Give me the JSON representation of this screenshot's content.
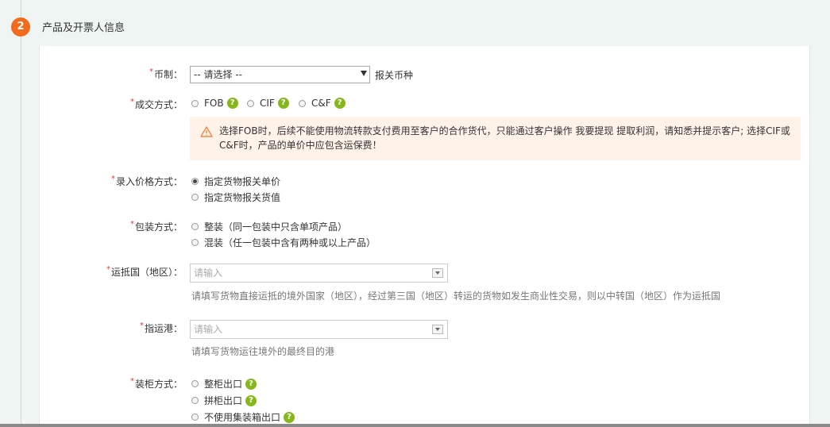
{
  "section": {
    "step": "2",
    "title": "产品及开票人信息"
  },
  "currency": {
    "label": "币制：",
    "selected": "-- 请选择 --",
    "suffix": "报关币种"
  },
  "trade_terms": {
    "label": "成交方式：",
    "options": [
      "FOB",
      "CIF",
      "C&F"
    ],
    "help": "?",
    "warning": "选择FOB时，后续不能使用物流转款支付费用至客户的合作货代，只能通过客户操作 我要提现 提取利润，请知悉并提示客户; 选择CIF或C&F时，产品的单价中应包含运保费！"
  },
  "price_method": {
    "label": "录入价格方式：",
    "options": [
      "指定货物报关单价",
      "指定货物报关货值"
    ],
    "selected_index": 0
  },
  "packing": {
    "label": "包装方式：",
    "options": [
      "整装（同一包装中只含单项产品）",
      "混装（任一包装中含有两种或以上产品）"
    ]
  },
  "destination_country": {
    "label": "运抵国（地区）：",
    "placeholder": "请输入",
    "hint": "请填写货物直接运抵的境外国家（地区），经过第三国（地区）转运的货物如发生商业性交易，则以中转国（地区）作为运抵国"
  },
  "destination_port": {
    "label": "指运港：",
    "placeholder": "请输入",
    "hint": "请填写货物运往境外的最终目的港"
  },
  "container": {
    "label": "装柜方式：",
    "options": [
      "整柜出口",
      "拼柜出口",
      "不使用集装箱出口"
    ],
    "help": "?"
  },
  "required_mark": "*",
  "colors": {
    "accent": "#f26a1b",
    "help": "#86b81c",
    "required": "#e4393c",
    "warning_bg": "#fff2e8"
  }
}
